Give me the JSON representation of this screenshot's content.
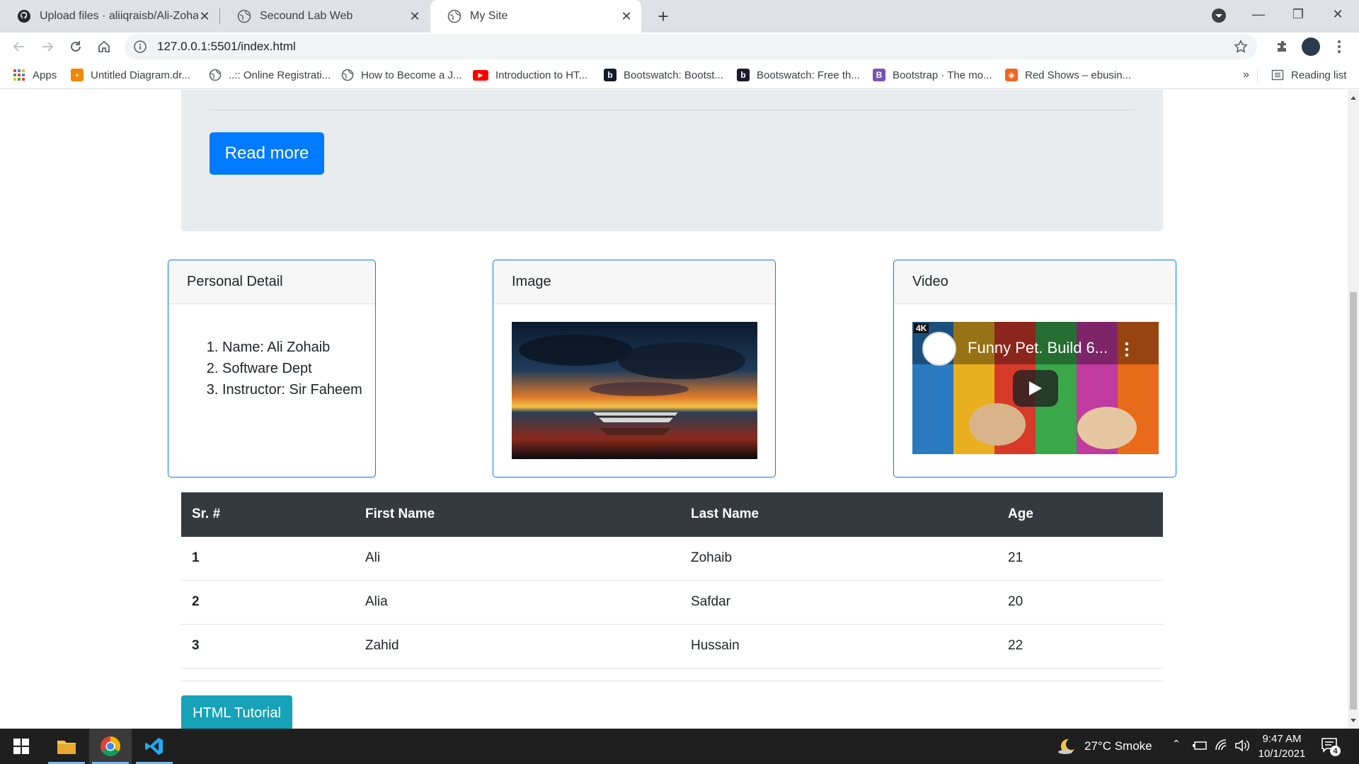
{
  "browser": {
    "tabs": [
      {
        "title": "Upload files · aliiqraisb/Ali-Zohaib",
        "icon": "github-icon",
        "active": false
      },
      {
        "title": "Secound Lab Web",
        "icon": "globe-icon",
        "active": false
      },
      {
        "title": "My Site",
        "icon": "globe-icon",
        "active": true
      }
    ],
    "url": "127.0.0.1:5501/index.html",
    "bookmarks": [
      {
        "label": "Apps",
        "icon": "apps-grid-icon"
      },
      {
        "label": "Untitled Diagram.dr...",
        "icon": "drawio-icon",
        "color": "#f08705"
      },
      {
        "label": "..:: Online Registrati...",
        "icon": "globe-icon"
      },
      {
        "label": "How to Become a J...",
        "icon": "globe-icon"
      },
      {
        "label": "Introduction to HT...",
        "icon": "youtube-icon",
        "color": "#ff0000"
      },
      {
        "label": "Bootswatch: Bootst...",
        "icon": "bootswatch-icon",
        "color": "#1a1a2e"
      },
      {
        "label": "Bootswatch: Free th...",
        "icon": "bootswatch-icon",
        "color": "#1a1a2e"
      },
      {
        "label": "Bootstrap · The mo...",
        "icon": "bootstrap-icon",
        "color": "#7952b3"
      },
      {
        "label": "Red Shows – ebusin...",
        "icon": "red-shows-icon",
        "color": "#f26522"
      }
    ],
    "overflow_label": "»",
    "reading_list_label": "Reading list"
  },
  "page": {
    "read_more_label": "Read more",
    "cards": {
      "personal": {
        "header": "Personal Detail",
        "items": [
          "Name: Ali Zohaib",
          "Software Dept",
          "Instructor: Sir Faheem"
        ]
      },
      "image": {
        "header": "Image"
      },
      "video": {
        "header": "Video",
        "video_title": "Funny Pet. Build 6...",
        "badge": "4K"
      }
    },
    "table": {
      "headers": [
        "Sr. #",
        "First Name",
        "Last Name",
        "Age"
      ],
      "rows": [
        [
          "1",
          "Ali",
          "Zohaib",
          "21"
        ],
        [
          "2",
          "Alia",
          "Safdar",
          "20"
        ],
        [
          "3",
          "Zahid",
          "Hussain",
          "22"
        ]
      ]
    },
    "html_tutorial_label": "HTML Tutorial"
  },
  "taskbar": {
    "weather": "27°C  Smoke",
    "time": "9:47 AM",
    "date": "10/1/2021",
    "notification_count": "4"
  },
  "colors": {
    "primary": "#007bff",
    "info": "#17a2b8",
    "table_header": "#343a40",
    "jumbotron": "#e9ecef"
  }
}
